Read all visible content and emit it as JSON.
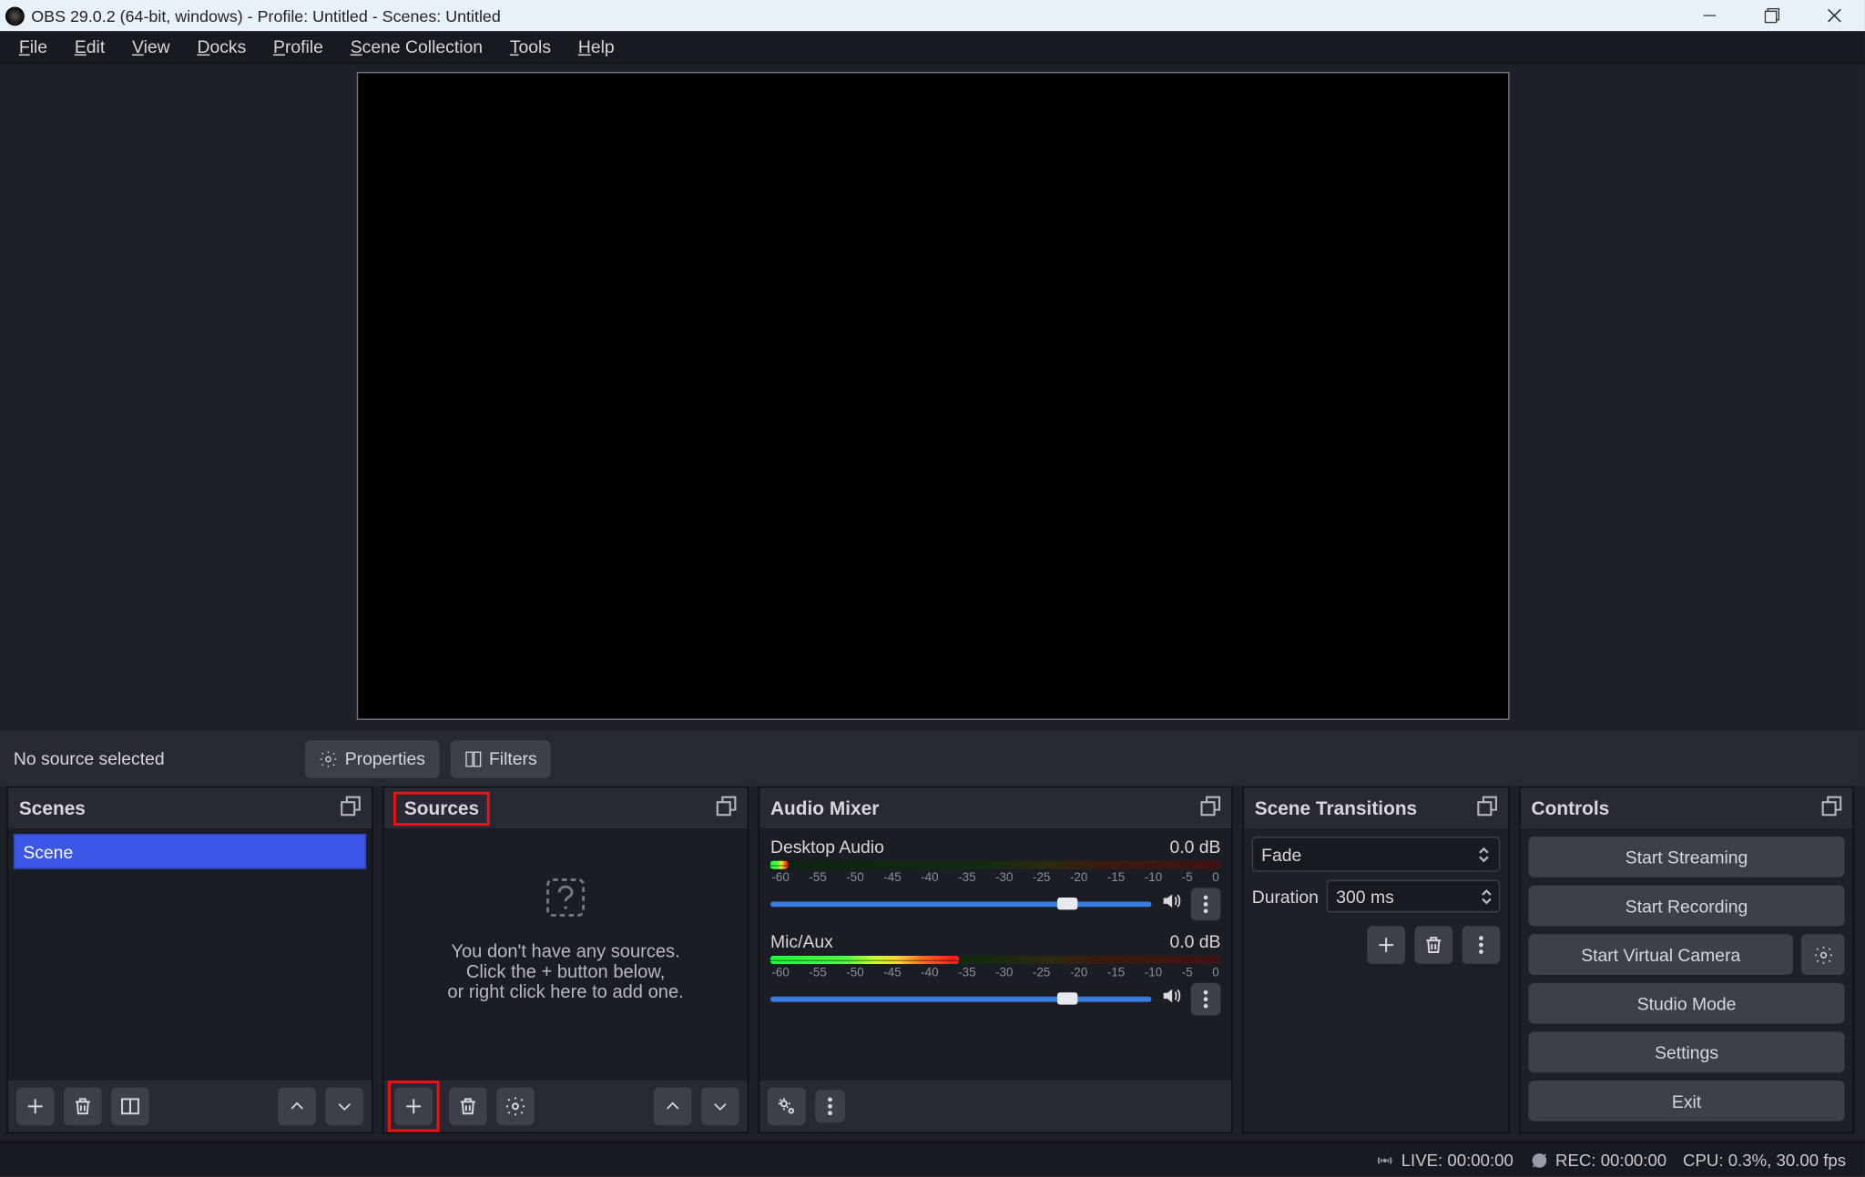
{
  "titlebar": {
    "title": "OBS 29.0.2 (64-bit, windows) - Profile: Untitled - Scenes: Untitled"
  },
  "menubar": {
    "items": [
      "File",
      "Edit",
      "View",
      "Docks",
      "Profile",
      "Scene Collection",
      "Tools",
      "Help"
    ]
  },
  "source_bar": {
    "selection_text": "No source selected",
    "properties_label": "Properties",
    "filters_label": "Filters"
  },
  "docks": {
    "scenes": {
      "title": "Scenes",
      "items": [
        "Scene"
      ]
    },
    "sources": {
      "title": "Sources",
      "empty_text_1": "You don't have any sources.",
      "empty_text_2": "Click the + button below,",
      "empty_text_3": "or right click here to add one."
    },
    "mixer": {
      "title": "Audio Mixer",
      "ticks": [
        "-60",
        "-55",
        "-50",
        "-45",
        "-40",
        "-35",
        "-30",
        "-25",
        "-20",
        "-15",
        "-10",
        "-5",
        "0"
      ],
      "channels": [
        {
          "name": "Desktop Audio",
          "db": "0.0 dB",
          "meter_fill_pct": 4,
          "slider_pct": 78
        },
        {
          "name": "Mic/Aux",
          "db": "0.0 dB",
          "meter_fill_pct": 42,
          "slider_pct": 78
        }
      ]
    },
    "transitions": {
      "title": "Scene Transitions",
      "selected": "Fade",
      "duration_label": "Duration",
      "duration_value": "300 ms"
    },
    "controls": {
      "title": "Controls",
      "buttons": {
        "start_streaming": "Start Streaming",
        "start_recording": "Start Recording",
        "start_virtual_camera": "Start Virtual Camera",
        "studio_mode": "Studio Mode",
        "settings": "Settings",
        "exit": "Exit"
      }
    }
  },
  "statusbar": {
    "live": "LIVE: 00:00:00",
    "rec": "REC: 00:00:00",
    "cpu": "CPU: 0.3%, 30.00 fps"
  }
}
